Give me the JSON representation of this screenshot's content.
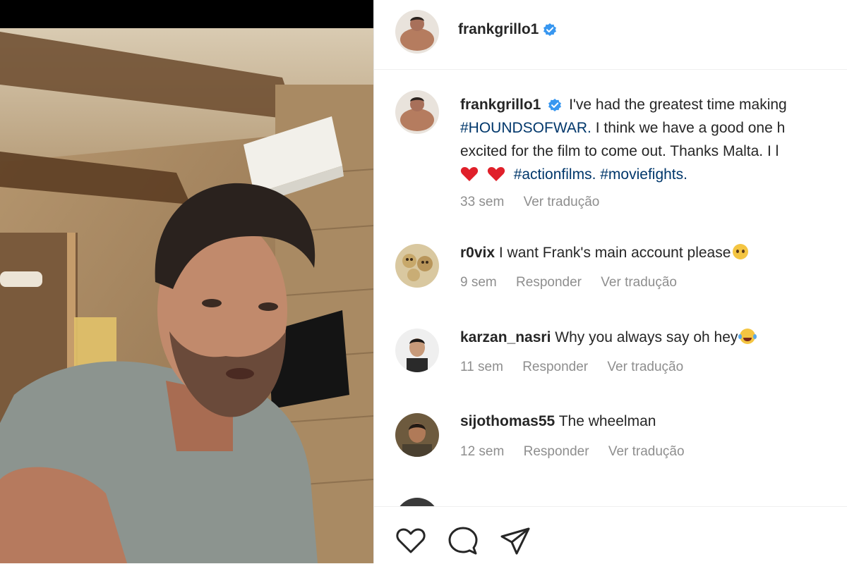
{
  "post": {
    "username": "frankgrillo1",
    "caption_lines": [
      "I've had the greatest time making",
      "I think we have a good one h",
      "excited for the film to come out. Thanks Malta. I l",
      ""
    ],
    "caption_hashtag_1": "#HOUNDSOFWAR.",
    "caption_hashtag_2": "#actionfilms.",
    "caption_hashtag_3": "#moviefights.",
    "caption_time": "33 sem",
    "caption_translate": "Ver tradução"
  },
  "comments": [
    {
      "username": "r0vix",
      "text": "I want Frank's main account please",
      "time": "9 sem",
      "reply": "Responder",
      "translate": "Ver tradução"
    },
    {
      "username": "karzan_nasri",
      "text": "Why you always say oh hey",
      "time": "11 sem",
      "reply": "Responder",
      "translate": "Ver tradução"
    },
    {
      "username": "sijothomas55",
      "text": "The wheelman",
      "time": "12 sem",
      "reply": "Responder",
      "translate": "Ver tradução"
    }
  ],
  "actions": {
    "like": "heart-icon",
    "comment": "comment-icon",
    "share": "share-icon"
  },
  "colors": {
    "verified": "#3897f0",
    "hashtag": "#00376b",
    "heart": "#ed4956",
    "meta": "#8e8e8e"
  }
}
